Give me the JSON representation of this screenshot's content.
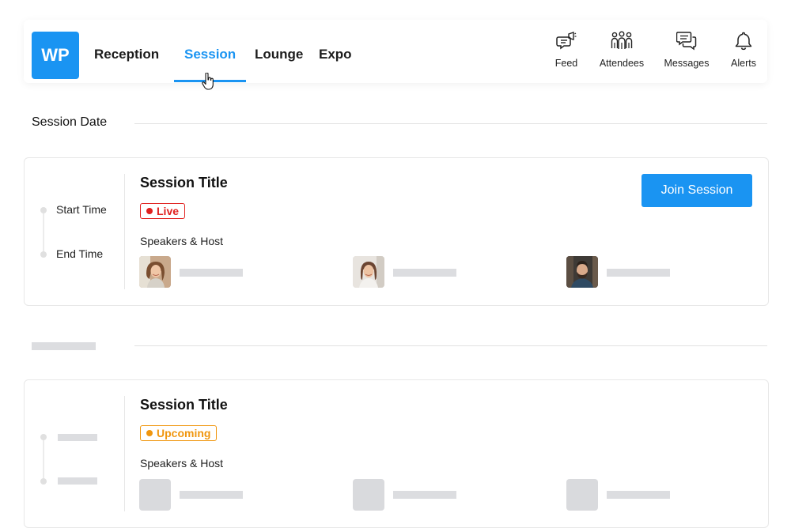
{
  "header": {
    "logo_text": "WP",
    "tabs": [
      {
        "label": "Reception",
        "active": false
      },
      {
        "label": "Session",
        "active": true
      },
      {
        "label": "Lounge",
        "active": false
      },
      {
        "label": "Expo",
        "active": false
      }
    ],
    "actions": [
      {
        "label": "Feed",
        "icon": "megaphone-chat-icon"
      },
      {
        "label": "Attendees",
        "icon": "people-icon"
      },
      {
        "label": "Messages",
        "icon": "chat-bubbles-icon"
      },
      {
        "label": "Alerts",
        "icon": "bell-icon"
      }
    ]
  },
  "colors": {
    "accent": "#1a94f2",
    "live": "#e0201e",
    "upcoming": "#f0960e",
    "placeholder": "#dcdde0"
  },
  "sessions": [
    {
      "date_label": "Session Date",
      "start_label": "Start Time",
      "end_label": "End Time",
      "title": "Session Title",
      "status": "Live",
      "speakers_label": "Speakers & Host",
      "join_label": "Join Session"
    },
    {
      "title": "Session Title",
      "status": "Upcoming",
      "speakers_label": "Speakers & Host"
    }
  ]
}
